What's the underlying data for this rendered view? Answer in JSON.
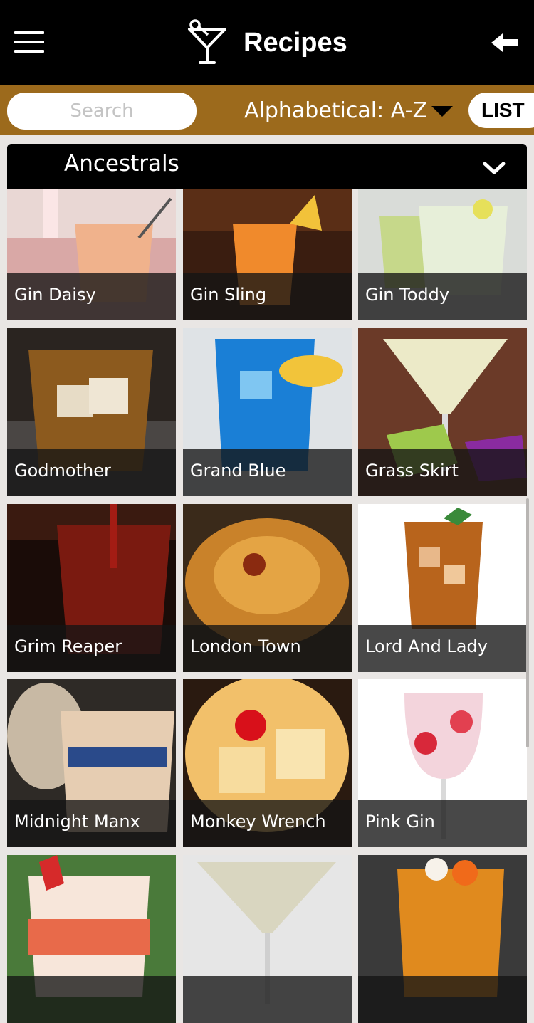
{
  "header": {
    "title": "Recipes",
    "logo_icon": "martini-glass-icon",
    "menu_icon": "hamburger-icon",
    "back_icon": "back-arrow-icon"
  },
  "filter": {
    "search_placeholder": "Search",
    "sort_label": "Alphabetical: A-Z",
    "view_toggle_label": "LIST"
  },
  "category": {
    "label": "Ancestrals"
  },
  "colors": {
    "header": "#000000",
    "filter_bar": "#9c6a1c",
    "background": "#e9e6e4"
  },
  "recipes": [
    {
      "name": "Gin Daisy"
    },
    {
      "name": "Gin Sling"
    },
    {
      "name": "Gin Toddy"
    },
    {
      "name": "Godmother"
    },
    {
      "name": "Grand Blue"
    },
    {
      "name": "Grass Skirt"
    },
    {
      "name": "Grim Reaper"
    },
    {
      "name": "London Town"
    },
    {
      "name": "Lord And Lady"
    },
    {
      "name": "Midnight Manx"
    },
    {
      "name": "Monkey Wrench"
    },
    {
      "name": "Pink Gin"
    },
    {
      "name": ""
    },
    {
      "name": ""
    },
    {
      "name": ""
    }
  ]
}
